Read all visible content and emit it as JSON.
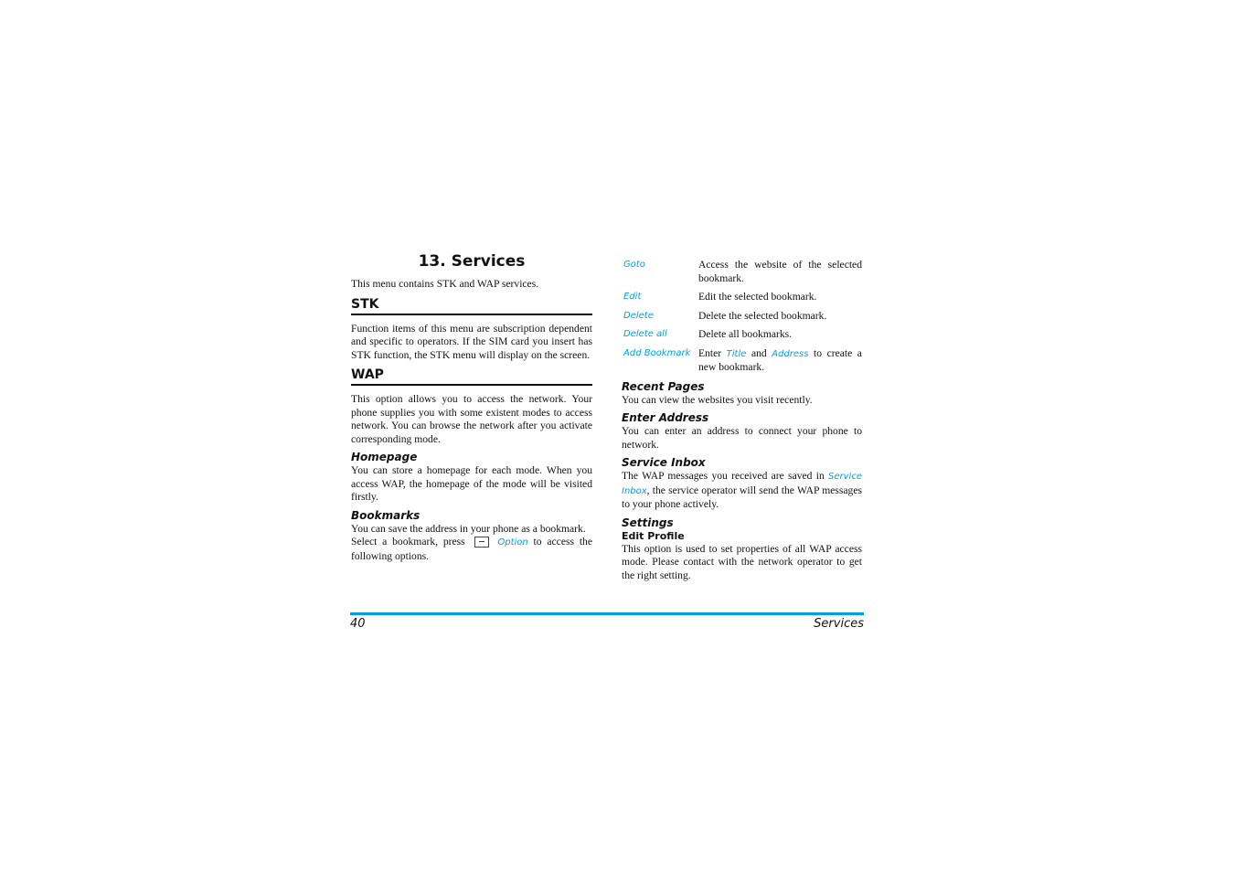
{
  "title": "13. Services",
  "intro": "This menu contains STK and WAP services.",
  "stk": {
    "heading": "STK",
    "text": "Function items of this menu are subscription dependent and specific to operators. If the SIM card you insert has STK function, the STK menu will display on the screen."
  },
  "wap": {
    "heading": "WAP",
    "text": "This option allows you to access the network. Your phone supplies you with some existent modes to access network. You can browse the network after you activate corresponding mode."
  },
  "homepage": {
    "heading": "Homepage",
    "text": "You can store a homepage for each mode. When you access WAP, the homepage of the mode will be visited firstly."
  },
  "bookmarks": {
    "heading": "Bookmarks",
    "text1": "You can save the address in your phone as a bookmark.",
    "text2a": "Select a bookmark, press",
    "key_icon": "left-softkey-icon",
    "option": "Option",
    "text2b": "to access the following options.",
    "options": [
      {
        "name": "Goto",
        "desc": "Access the website of the selected bookmark."
      },
      {
        "name": "Edit",
        "desc": "Edit the selected bookmark."
      },
      {
        "name": "Delete",
        "desc": "Delete the selected bookmark."
      },
      {
        "name": "Delete all",
        "desc": "Delete all bookmarks."
      },
      {
        "name": "Add Bookmark",
        "desc_a": "Enter",
        "desc_title": "Title",
        "desc_b": "and",
        "desc_address": "Address",
        "desc_c": "to create a new bookmark."
      }
    ]
  },
  "recent": {
    "heading": "Recent Pages",
    "text": "You can view the websites you visit recently."
  },
  "enter": {
    "heading": "Enter Address",
    "text": "You can enter an address to connect your phone to network."
  },
  "inbox": {
    "heading": "Service Inbox",
    "text_a": "The WAP messages you received are saved in",
    "link": "Service Inbox",
    "text_b": ", the service operator will send the WAP messages to your phone actively."
  },
  "settings": {
    "heading": "Settings",
    "sub": "Edit Profile",
    "text": "This option is used to set properties of all WAP access mode. Please contact with the network operator to get the right setting."
  },
  "footer": {
    "page": "40",
    "section": "Services"
  },
  "colors": {
    "accent": "#00a0e3"
  }
}
